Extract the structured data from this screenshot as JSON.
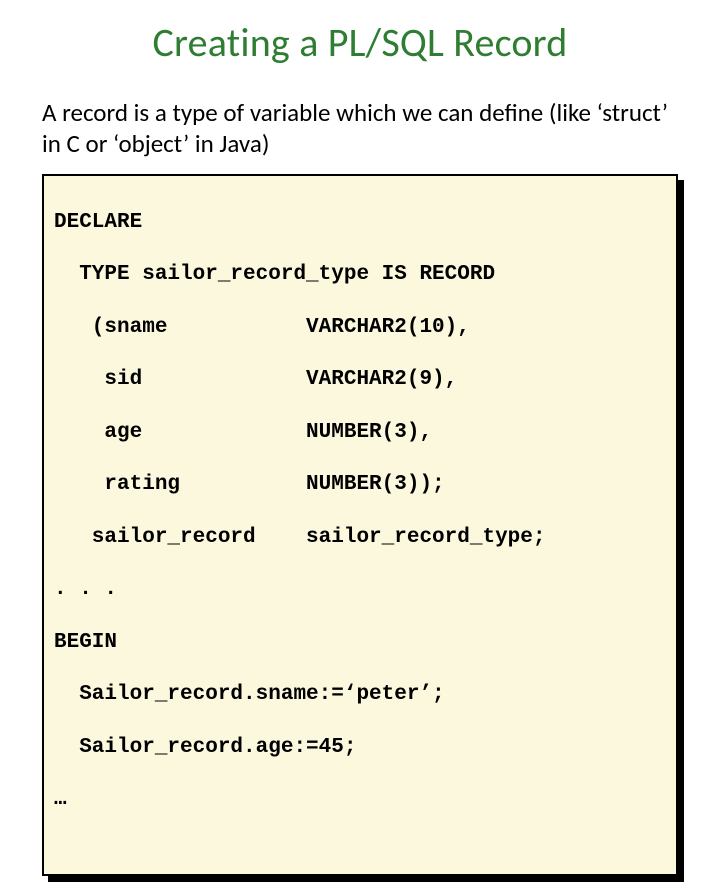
{
  "title": "Creating a PL/SQL Record",
  "body": "A record is a type of variable which we can define (like ‘struct’ in C or ‘object’ in Java)",
  "code": {
    "l01": "DECLARE",
    "l02": "  TYPE sailor_record_type IS RECORD",
    "l03": "   (sname           VARCHAR2(10),",
    "l04": "    sid             VARCHAR2(9),",
    "l05": "    age             NUMBER(3),",
    "l06": "    rating          NUMBER(3));",
    "l07": "   sailor_record    sailor_record_type;",
    "l08": ". . .",
    "l09": "BEGIN",
    "l10": "  Sailor_record.sname:=‘peter’;",
    "l11": "  Sailor_record.age:=45;",
    "l12": "…"
  }
}
